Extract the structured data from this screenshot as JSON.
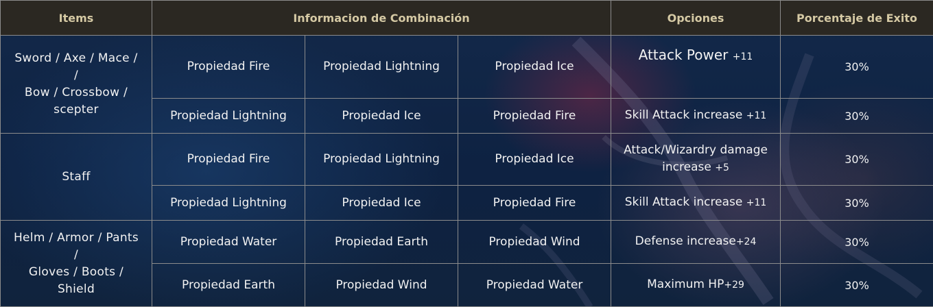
{
  "headers": {
    "items": "Items",
    "combination": "Informacion de Combinación",
    "options": "Opciones",
    "success": "Porcentaje de Exito"
  },
  "groups": [
    {
      "items_lines": [
        "Sword / Axe / Mace /",
        "/",
        "Bow / Crossbow /",
        "scepter"
      ],
      "rows": [
        {
          "props": [
            "Propiedad Fire",
            "Propiedad Lightning",
            "Propiedad Ice"
          ],
          "option_name": "Attack Power ",
          "option_bonus": "+11",
          "percent": "30%"
        },
        {
          "props": [
            "Propiedad Lightning",
            "Propiedad Ice",
            "Propiedad Fire"
          ],
          "option_name": "Skill Attack increase ",
          "option_bonus": "+11",
          "percent": "30%"
        }
      ]
    },
    {
      "items_lines": [
        "Staff"
      ],
      "rows": [
        {
          "props": [
            "Propiedad Fire",
            "Propiedad Lightning",
            "Propiedad Ice"
          ],
          "option_line1": "Attack/Wizardry damage",
          "option_name": "increase ",
          "option_bonus": "+5",
          "percent": "30%"
        },
        {
          "props": [
            "Propiedad Lightning",
            "Propiedad Ice",
            "Propiedad Fire"
          ],
          "option_name": "Skill Attack increase ",
          "option_bonus": "+11",
          "percent": "30%"
        }
      ]
    },
    {
      "items_lines": [
        "Helm / Armor / Pants",
        "/",
        "Gloves / Boots /",
        "Shield"
      ],
      "rows": [
        {
          "props": [
            "Propiedad Water",
            "Propiedad Earth",
            "Propiedad Wind"
          ],
          "option_name": "Defense increase",
          "option_bonus": "+24",
          "percent": "30%"
        },
        {
          "props": [
            "Propiedad Earth",
            "Propiedad Wind",
            "Propiedad Water"
          ],
          "option_name": "Maximum HP",
          "option_bonus": "+29",
          "percent": "30%"
        }
      ]
    }
  ],
  "colors": {
    "header_bg": "#2b2822",
    "header_text": "#d5c9a4",
    "border": "#8c8c8c",
    "body_bg": "#0f2340"
  }
}
